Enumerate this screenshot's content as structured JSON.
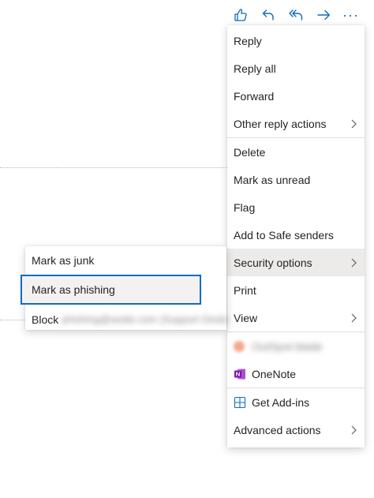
{
  "toolbar": {
    "icons": [
      "like-icon",
      "reply-icon",
      "reply-all-icon",
      "forward-icon",
      "more-icon"
    ],
    "more_glyph": "···",
    "accent": "#0f6cbd"
  },
  "menu": {
    "reply": "Reply",
    "reply_all": "Reply all",
    "forward": "Forward",
    "other_reply_actions": "Other reply actions",
    "delete": "Delete",
    "mark_unread": "Mark as unread",
    "flag": "Flag",
    "add_safe_senders": "Add to Safe senders",
    "security_options": "Security options",
    "print": "Print",
    "view": "View",
    "addin_blurred": "OutSpot blade",
    "onenote": "OneNote",
    "get_addins": "Get Add-ins",
    "advanced_actions": "Advanced actions"
  },
  "submenu": {
    "mark_junk": "Mark as junk",
    "mark_phishing": "Mark as phishing",
    "block_label": "Block",
    "block_sender_blurred": "phishing@aside.com (Support Desk)"
  }
}
